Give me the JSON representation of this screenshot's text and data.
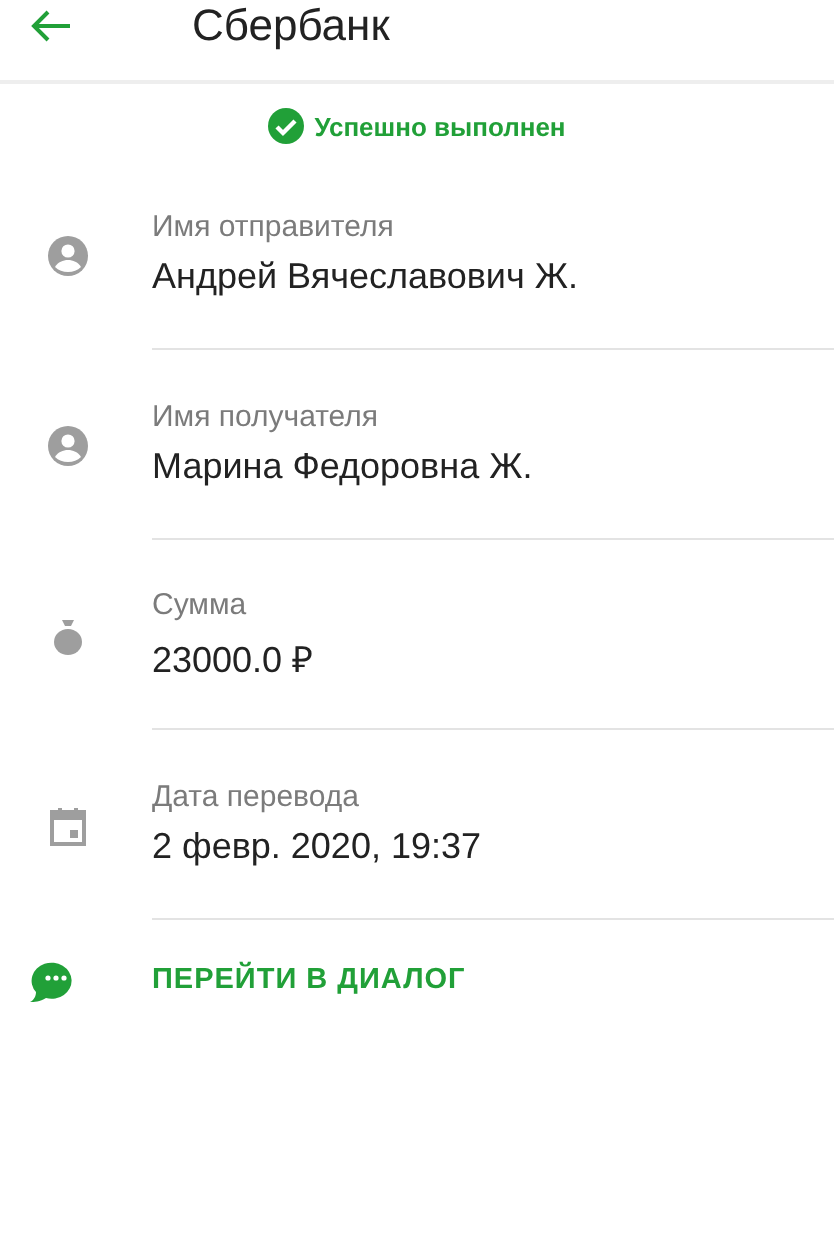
{
  "header": {
    "title": "Сбербанк"
  },
  "status": {
    "text": "Успешно выполнен"
  },
  "details": [
    {
      "kind": "person",
      "label": "Имя отправителя",
      "value": "Андрей Вячеславович Ж."
    },
    {
      "kind": "person",
      "label": "Имя получателя",
      "value": "Марина Федоровна Ж."
    },
    {
      "kind": "money",
      "label": "Сумма",
      "value": "23000.0 ₽"
    },
    {
      "kind": "date",
      "label": "Дата перевода",
      "value": "2 февр. 2020, 19:37"
    }
  ],
  "action": {
    "label": "ПЕРЕЙТИ В ДИАЛОГ"
  }
}
